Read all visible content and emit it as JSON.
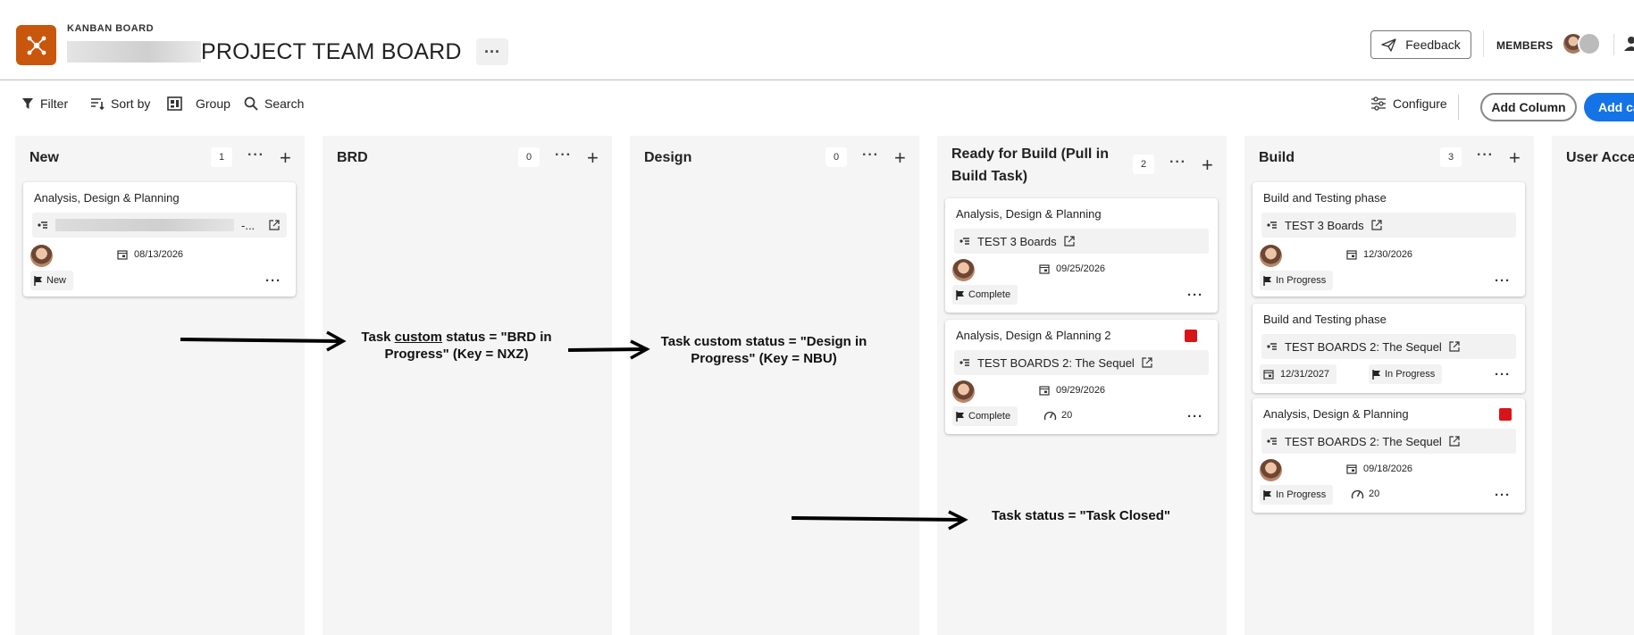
{
  "header": {
    "app_label": "KANBAN BOARD",
    "board_title": "PROJECT TEAM BOARD",
    "feedback_label": "Feedback",
    "members_label": "MEMBERS"
  },
  "toolbar": {
    "filter": "Filter",
    "sort": "Sort by",
    "group": "Group",
    "search": "Search",
    "configure": "Configure",
    "add_column": "Add Column",
    "add_card": "Add ca"
  },
  "columns": [
    {
      "title": "New",
      "count": "1"
    },
    {
      "title": "BRD",
      "count": "0"
    },
    {
      "title": "Design",
      "count": "0"
    },
    {
      "title": "Ready for Build (Pull in Build Task)",
      "count": "2"
    },
    {
      "title": "Build",
      "count": "3"
    },
    {
      "title": "User Accep"
    }
  ],
  "cards": {
    "new_1": {
      "title": "Analysis, Design & Planning",
      "project_suffix": "-...",
      "date": "08/13/2026",
      "status": "New"
    },
    "ready_1": {
      "title": "Analysis, Design & Planning",
      "project": "TEST 3 Boards",
      "date": "09/25/2026",
      "status": "Complete"
    },
    "ready_2": {
      "title": "Analysis, Design & Planning 2",
      "project": "TEST BOARDS 2: The Sequel",
      "date": "09/29/2026",
      "status": "Complete",
      "effort": "20"
    },
    "build_1": {
      "title": "Build and Testing phase",
      "project": "TEST 3 Boards",
      "date": "12/30/2026",
      "status": "In Progress"
    },
    "build_2": {
      "title": "Build and Testing phase",
      "project": "TEST BOARDS 2: The Sequel",
      "date": "12/31/2027",
      "status": "In Progress"
    },
    "build_3": {
      "title": "Analysis, Design & Planning",
      "project": "TEST BOARDS 2: The Sequel",
      "date": "09/18/2026",
      "status": "In Progress",
      "effort": "20"
    }
  },
  "annotations": {
    "brd_prefix": "Task ",
    "brd_underlined": "custom",
    "brd_rest": " status = \"BRD in Progress\" (Key = NXZ)",
    "design": "Task custom status = \"Design in Progress\" (Key = NBU)",
    "closed": "Task status = \"Task Closed\""
  },
  "colors": {
    "accent": "#1473e6",
    "logo": "#c9560d",
    "priority_flag": "#d7141a",
    "column_bg": "#f5f5f5"
  },
  "icons": [
    "hub-icon",
    "send-icon",
    "filter-icon",
    "sort-icon",
    "group-icon",
    "search-icon",
    "sliders-icon",
    "project-icon",
    "external-link-icon",
    "calendar-icon",
    "flag-icon",
    "gauge-icon",
    "user-icon"
  ]
}
